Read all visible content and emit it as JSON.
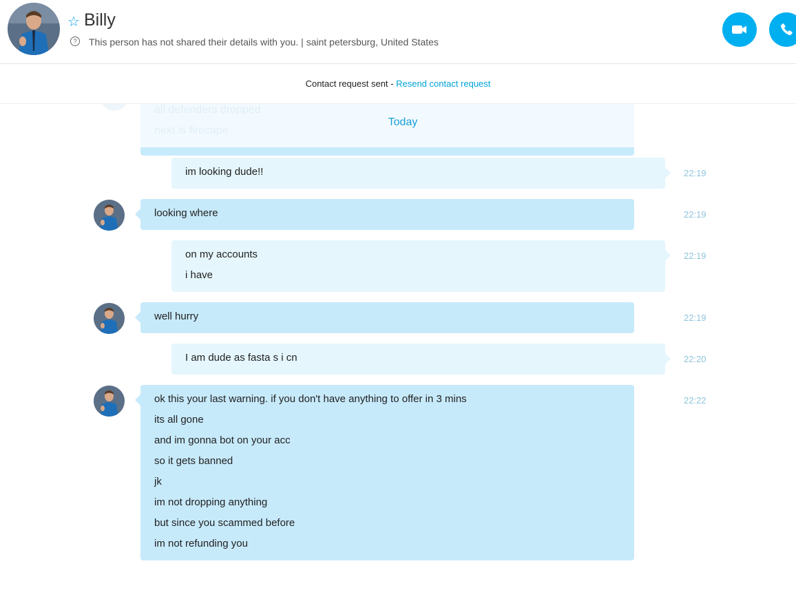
{
  "contact": {
    "name": "Billy",
    "details": "This person has not shared their details with you.  |  saint petersburg, United States"
  },
  "request_bar": {
    "status": "Contact request sent - ",
    "link": "Resend contact request"
  },
  "conversation": {
    "faded_lines": [
      "all defenders dropped",
      "next is firecape"
    ],
    "date_separator": "Today",
    "messages": [
      {
        "sender": "me",
        "time": "22:19",
        "lines": [
          "im looking dude!!"
        ]
      },
      {
        "sender": "them",
        "time": "22:19",
        "lines": [
          "looking where"
        ]
      },
      {
        "sender": "me",
        "time": "22:19",
        "lines": [
          "on my accounts",
          "i have"
        ]
      },
      {
        "sender": "them",
        "time": "22:19",
        "lines": [
          "well hurry"
        ]
      },
      {
        "sender": "me",
        "time": "22:20",
        "lines": [
          "I am dude as fasta s i cn"
        ]
      },
      {
        "sender": "them",
        "time": "22:22",
        "lines": [
          "ok this your last warning. if you don't have anything to offer in 3 mins",
          "its all gone",
          "and im gonna bot on your acc",
          "so it gets banned",
          "jk",
          "im not dropping anything",
          "but since you scammed before",
          "im not refunding you"
        ]
      }
    ]
  },
  "colors": {
    "accent": "#00aff0",
    "their_bubble": "#c7eafb",
    "my_bubble": "#e5f6fd",
    "timestamp": "#8fc5dc"
  }
}
